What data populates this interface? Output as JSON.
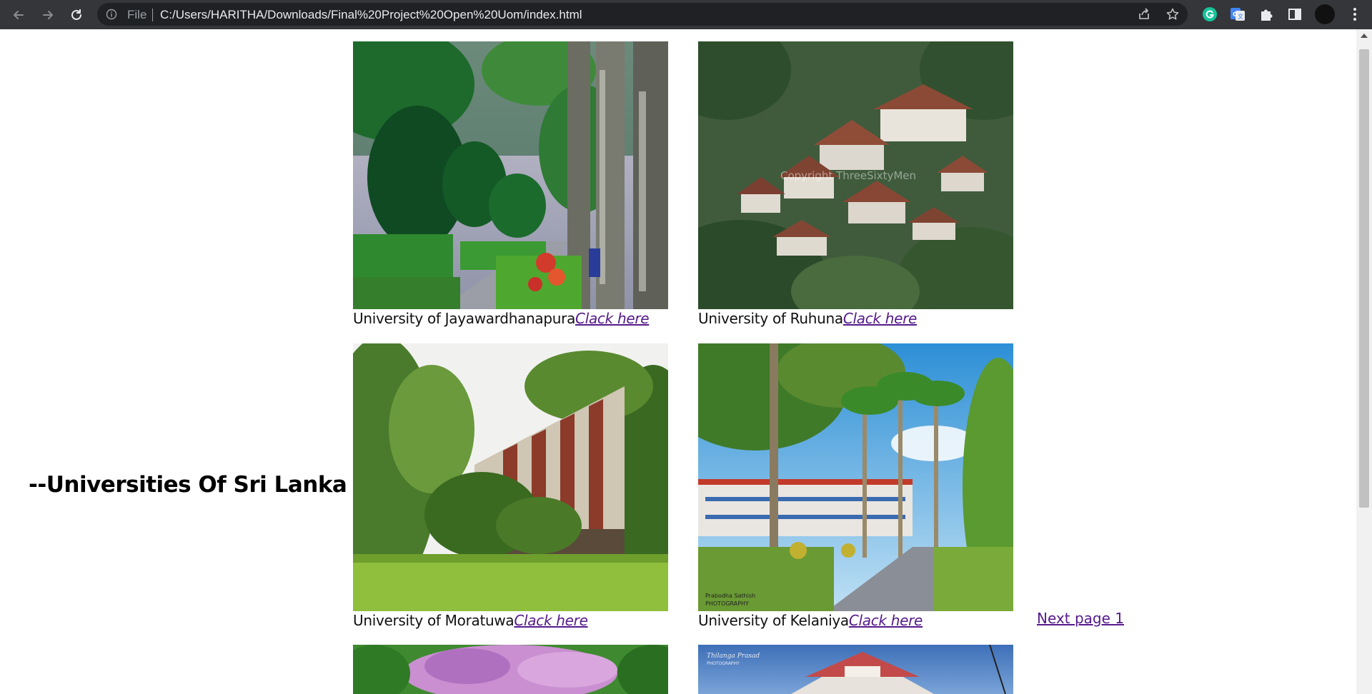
{
  "browser": {
    "file_label": "File",
    "url": "C:/Users/HARITHA/Downloads/Final%20Project%20Open%20Uom/index.html",
    "icons": [
      "back-icon",
      "forward-icon",
      "reload-icon",
      "info-icon",
      "share-icon",
      "star-icon",
      "grammarly-icon",
      "translate-icon",
      "puzzle-icon",
      "sidepanel-icon",
      "profile-avatar",
      "more-icon"
    ],
    "accent_colors": {
      "grammarly": "#15c39a",
      "translate": "#4285f4"
    }
  },
  "page": {
    "heading": "--Universities Of Sri Lanka --",
    "link_color": "#551a8b",
    "universities": [
      {
        "name": "University of Jayawardhanapura",
        "link": "Clack here"
      },
      {
        "name": "University of Ruhuna",
        "link": "Clack here"
      },
      {
        "name": "University of Moratuwa",
        "link": "Clack here"
      },
      {
        "name": "University of Kelaniya",
        "link": "Clack here"
      }
    ],
    "watermarks": {
      "ruhuna": "Copyright ThreeSixtyMen",
      "kelaniya": "Prabodha Sathish\nPHOTOGRAPHY",
      "row3": "Thilanga Prasad\nPHOTOGRAPHY"
    },
    "next_link": "Next page 1"
  }
}
